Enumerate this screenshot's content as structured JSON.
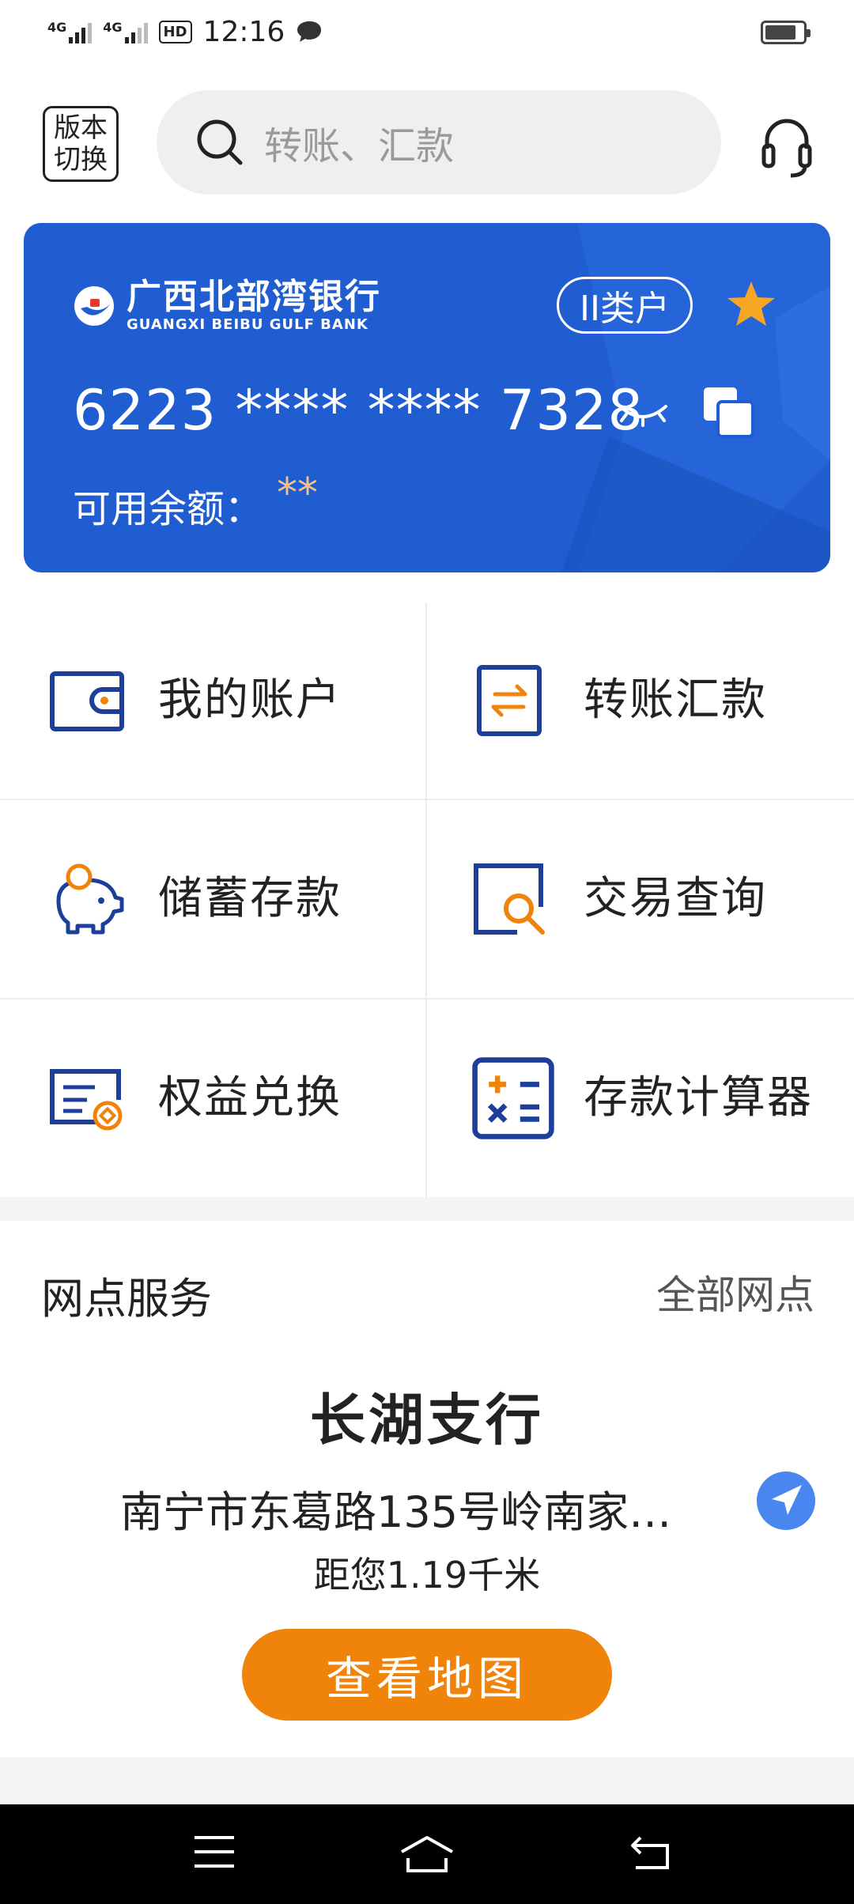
{
  "status_bar": {
    "time": "12:16",
    "signal1_label": "4G",
    "signal2_label": "4G",
    "hd_label": "HD"
  },
  "header": {
    "switch_label": "版本切换",
    "search_placeholder": "转账、汇款"
  },
  "card": {
    "bank_name_cn": "广西北部湾银行",
    "bank_name_en": "GUANGXI BEIBU GULF BANK",
    "account_type": "II类户",
    "card_number": "6223 **** **** 7328",
    "balance_label": "可用余额：",
    "balance_value": "**",
    "colors": {
      "card_bg": "#1f5dd0",
      "star": "#f5a623",
      "balance": "#f5c188"
    }
  },
  "menu": {
    "items": [
      {
        "label": "我的账户",
        "icon": "wallet-icon"
      },
      {
        "label": "转账汇款",
        "icon": "transfer-icon"
      },
      {
        "label": "储蓄存款",
        "icon": "piggy-bank-icon"
      },
      {
        "label": "交易查询",
        "icon": "transaction-search-icon"
      },
      {
        "label": "权益兑换",
        "icon": "rights-exchange-icon"
      },
      {
        "label": "存款计算器",
        "icon": "calculator-icon"
      }
    ]
  },
  "branch": {
    "section_title": "网点服务",
    "all_link": "全部网点",
    "name": "长湖支行",
    "address": "南宁市东葛路135号岭南家…",
    "distance": "距您1.19千米",
    "map_button": "查看地图",
    "colors": {
      "map_button": "#f0840a",
      "nav_icon": "#4a86f0"
    }
  }
}
